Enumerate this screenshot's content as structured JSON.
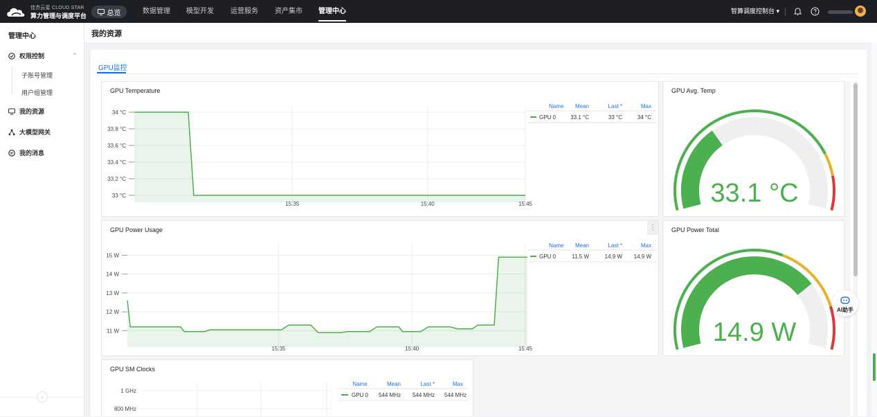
{
  "topnav": {
    "logo_line1": "佳杰云星 CLOUD STAR",
    "logo_line2": "算力管理与调度平台",
    "overview": "总览",
    "items": [
      "数据管理",
      "模型开发",
      "运营服务",
      "资产集市",
      "管理中心"
    ],
    "active_item": "管理中心",
    "console": "智算调度控制台 ▾"
  },
  "sidebar": {
    "title": "管理中心",
    "items": [
      {
        "label": "权限控制",
        "icon": "shield-check-icon"
      },
      {
        "label": "我的资源",
        "icon": "monitor-icon"
      },
      {
        "label": "大模型网关",
        "icon": "network-icon"
      },
      {
        "label": "我的消息",
        "icon": "message-icon"
      }
    ],
    "sub_items": [
      "子账号管理",
      "用户组管理"
    ]
  },
  "page": {
    "title": "我的资源",
    "tab": "GPU监控"
  },
  "legend_headers": [
    "Name",
    "Mean",
    "Last *",
    "Max"
  ],
  "ai_assistant": "AI助手",
  "panels": {
    "temp": {
      "title": "GPU Temperature",
      "legend": {
        "name": "GPU 0",
        "mean": "33.1 °C",
        "last": "33 °C",
        "max": "34 °C"
      }
    },
    "avg_temp": {
      "title": "GPU Avg. Temp",
      "value": "33.1 °C"
    },
    "power": {
      "title": "GPU Power Usage",
      "legend": {
        "name": "GPU 0",
        "mean": "11.5 W",
        "last": "14.9 W",
        "max": "14.9 W"
      }
    },
    "power_total": {
      "title": "GPU Power Total",
      "value": "14.9 W"
    },
    "sm": {
      "title": "GPU SM Clocks",
      "legend": {
        "name": "GPU 0",
        "mean": "544 MHz",
        "last": "544 MHz",
        "max": "544 MHz"
      }
    }
  },
  "chart_data": [
    {
      "type": "area",
      "title": "GPU Temperature",
      "series_color": "#4caf50",
      "yticks": [
        "33 °C",
        "33.2 °C",
        "33.4 °C",
        "33.6 °C",
        "33.8 °C",
        "34 °C"
      ],
      "ylim": [
        33,
        34
      ],
      "xticks": [
        "15:35",
        "15:40",
        "15:45"
      ],
      "series": [
        {
          "name": "GPU 0",
          "points": [
            [
              0,
              34
            ],
            [
              0.138,
              34
            ],
            [
              0.152,
              33
            ],
            [
              1.0,
              33
            ]
          ]
        }
      ]
    },
    {
      "type": "area",
      "title": "GPU Power Usage",
      "series_color": "#4caf50",
      "yticks": [
        "11 W",
        "12 W",
        "13 W",
        "14 W",
        "15 W"
      ],
      "ylim": [
        10.5,
        15.2
      ],
      "xticks": [
        "15:35",
        "15:40",
        "15:45"
      ],
      "series": [
        {
          "name": "GPU 0",
          "points": [
            [
              0,
              12.6
            ],
            [
              0.008,
              11.2
            ],
            [
              0.08,
              11.2
            ],
            [
              0.145,
              11.2
            ],
            [
              0.155,
              10.95
            ],
            [
              0.21,
              10.95
            ],
            [
              0.225,
              11.05
            ],
            [
              0.39,
              11.05
            ],
            [
              0.42,
              11.05
            ],
            [
              0.44,
              11.3
            ],
            [
              0.5,
              11.3
            ],
            [
              0.52,
              10.9
            ],
            [
              0.58,
              10.9
            ],
            [
              0.6,
              10.95
            ],
            [
              0.66,
              10.95
            ],
            [
              0.68,
              11.2
            ],
            [
              0.74,
              11.2
            ],
            [
              0.75,
              10.95
            ],
            [
              0.8,
              10.95
            ],
            [
              0.82,
              11.2
            ],
            [
              0.88,
              11.2
            ],
            [
              0.9,
              11.1
            ],
            [
              0.94,
              11.1
            ],
            [
              0.955,
              11.3
            ],
            [
              1.0,
              11.3
            ],
            [
              1.0,
              11.3
            ],
            [
              1.012,
              14.9
            ],
            [
              1.09,
              14.9
            ]
          ]
        }
      ]
    },
    {
      "type": "gauge",
      "title": "GPU Avg. Temp",
      "value": 33.1,
      "unit": "°C",
      "min": 0,
      "max": 100,
      "thresholds": [
        {
          "color": "#4caf50",
          "to": 80
        },
        {
          "color": "#e8b12c",
          "to": 88
        },
        {
          "color": "#d93a3a",
          "to": 100
        }
      ]
    },
    {
      "type": "gauge",
      "title": "GPU Power Total",
      "value": 14.9,
      "unit": "W",
      "min": 0,
      "max": 20,
      "thresholds": [
        {
          "color": "#4caf50",
          "to": 12
        },
        {
          "color": "#e8b12c",
          "to": 17
        },
        {
          "color": "#d93a3a",
          "to": 20
        }
      ]
    },
    {
      "type": "line",
      "title": "GPU SM Clocks",
      "series_color": "#4caf50",
      "yticks": [
        "800 MHz",
        "1 GHz"
      ],
      "series": [
        {
          "name": "GPU 0",
          "mean": 544,
          "last": 544,
          "max": 544
        }
      ]
    }
  ]
}
